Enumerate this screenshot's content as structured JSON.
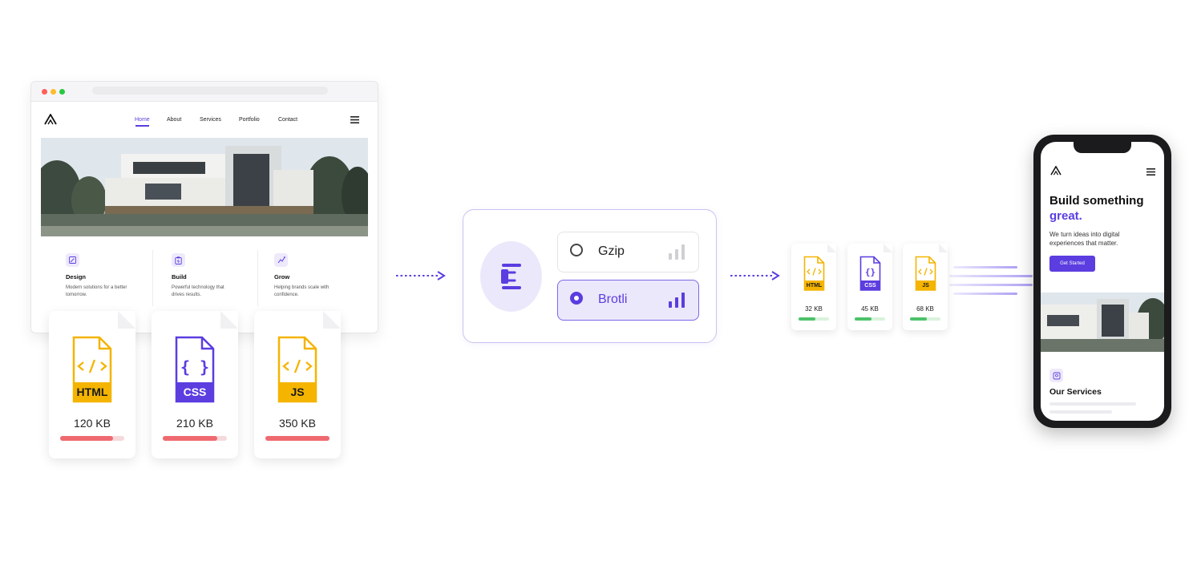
{
  "colors": {
    "accent": "#5b3de0",
    "html_yellow": "#f4b400",
    "css_purple": "#5b3de0",
    "size_bar_red": "#ef6a70",
    "size_bar_green": "#4dc26a"
  },
  "website": {
    "nav": [
      "Home",
      "About",
      "Services",
      "Portfolio",
      "Contact"
    ],
    "features": [
      {
        "icon": "design-icon",
        "title": "Design",
        "desc": "Modern solutions for a better tomorrow."
      },
      {
        "icon": "build-icon",
        "title": "Build",
        "desc": "Powerful technology that drives results."
      },
      {
        "icon": "grow-icon",
        "title": "Grow",
        "desc": "Helping brands scale with confidence."
      }
    ]
  },
  "original_files": [
    {
      "type": "HTML",
      "size": "120 KB",
      "bar_fill_pct": 82
    },
    {
      "type": "CSS",
      "size": "210 KB",
      "bar_fill_pct": 85
    },
    {
      "type": "JS",
      "size": "350 KB",
      "bar_fill_pct": 100
    }
  ],
  "compression": {
    "options": [
      {
        "label": "Gzip",
        "selected": false
      },
      {
        "label": "Brotli",
        "selected": true
      }
    ]
  },
  "compressed_files": [
    {
      "type": "HTML",
      "size": "32 KB",
      "bar_fill_pct": 55
    },
    {
      "type": "CSS",
      "size": "45 KB",
      "bar_fill_pct": 55
    },
    {
      "type": "JS",
      "size": "68 KB",
      "bar_fill_pct": 55
    }
  ],
  "phone": {
    "headline": "Build something",
    "headline_accent": "great.",
    "subtext": "We turn ideas into digital experiences that matter.",
    "cta": "Get Started",
    "section_title": "Our Services"
  }
}
